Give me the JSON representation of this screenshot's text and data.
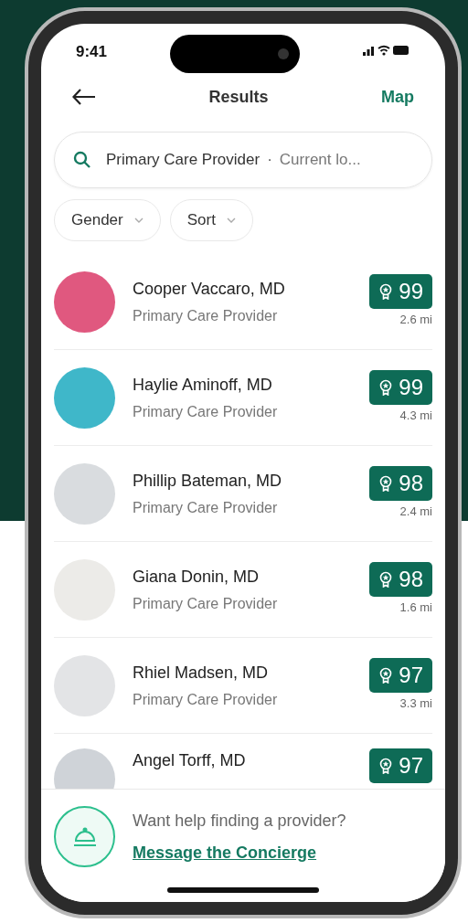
{
  "status_bar": {
    "time": "9:41"
  },
  "header": {
    "title": "Results",
    "action": "Map"
  },
  "search": {
    "query": "Primary Care Provider",
    "separator": "·",
    "location": "Current lo..."
  },
  "filters": [
    {
      "label": "Gender"
    },
    {
      "label": "Sort"
    }
  ],
  "providers": [
    {
      "kind": "full",
      "name": "Cooper Vaccaro, MD",
      "specialty": "Primary Care Provider",
      "score": "99",
      "distance": "2.6 mi"
    },
    {
      "kind": "full",
      "name": "Haylie Aminoff, MD",
      "specialty": "Primary Care Provider",
      "score": "99",
      "distance": "4.3 mi"
    },
    {
      "kind": "full",
      "name": "Phillip Bateman, MD",
      "specialty": "Primary Care Provider",
      "score": "98",
      "distance": "2.4 mi"
    },
    {
      "kind": "full",
      "name": "Giana Donin, MD",
      "specialty": "Primary Care Provider",
      "score": "98",
      "distance": "1.6 mi"
    },
    {
      "kind": "full",
      "name": "Rhiel Madsen, MD",
      "specialty": "Primary Care Provider",
      "score": "97",
      "distance": "3.3 mi"
    },
    {
      "kind": "partial",
      "name": "Angel Torff, MD",
      "score": "97"
    }
  ],
  "footer": {
    "prompt": "Want help finding a provider?",
    "link": "Message the Concierge"
  }
}
